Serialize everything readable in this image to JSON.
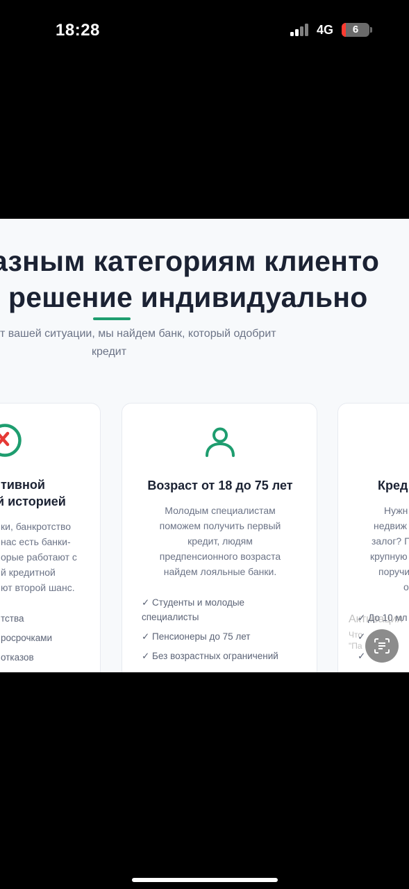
{
  "status_bar": {
    "time": "18:28",
    "network": "4G",
    "battery": "6",
    "battery_level_percent": 6
  },
  "hero": {
    "title_line1": "азным категориям клиенто",
    "title_line2": "решение индивидуально",
    "subtitle_line1": "т вашей ситуации, мы найдем банк, который одобрит",
    "subtitle_line2": "кредит"
  },
  "cards": {
    "left": {
      "icon": "x-circle-icon",
      "title_line1": "тивной",
      "title_line2": "й историей",
      "text": [
        "ки, банкротство",
        "нас есть банки-",
        "орые работают с",
        "й кредитной",
        "ют второй шанс."
      ],
      "checks": [
        "тства",
        "росрочками",
        "отказов"
      ]
    },
    "middle": {
      "icon": "user-icon",
      "title": "Возраст от 18 до 75 лет",
      "text": [
        "Молодым специалистам",
        "поможем получить первый",
        "кредит, людям",
        "предпенсионного возраста",
        "найдем лояльные банки."
      ],
      "checks": [
        "✓ Студенты и молодые",
        "специалисты",
        "✓ Пенсионеры до 75 лет",
        "✓ Без возрастных ограничений"
      ]
    },
    "right": {
      "title": "Кред",
      "text": [
        "Нужн",
        "недвиж",
        "залог? Г",
        "крупную",
        "поручи",
        "о"
      ],
      "checks": [
        "✓ До 10 мл",
        "✓",
        "✓"
      ]
    }
  },
  "overlay": {
    "activation_line1": "Активация",
    "activation_line2": "Что",
    "activation_line3": "\"Па"
  },
  "colors": {
    "accent": "#1e9d6f",
    "error": "#e53935",
    "heading": "#1b2233",
    "body_text": "#6b7386"
  }
}
